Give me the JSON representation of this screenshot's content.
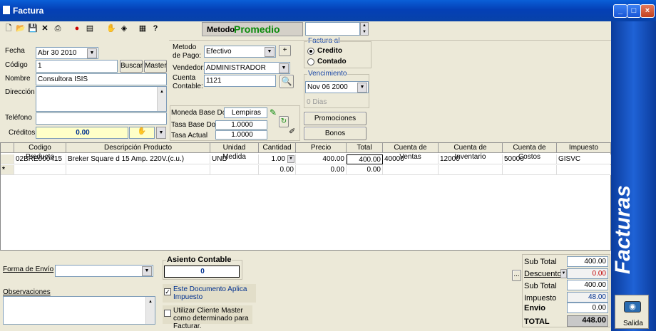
{
  "window": {
    "title": "Factura",
    "sidebar_label": "Facturas",
    "exit_label": "Salida"
  },
  "toolbar": {
    "metodo_label": "Metodo",
    "metodo_value": "Promedio"
  },
  "header": {
    "fecha_label": "Fecha",
    "fecha_value": "Abr 30 2010",
    "codigo_label": "Código",
    "codigo_value": "1",
    "buscar": "Buscar",
    "master": "Master",
    "nombre_label": "Nombre",
    "nombre_value": "Consultora ISIS",
    "direccion_label": "Dirección",
    "direccion_value": "",
    "telefono_label": "Teléfono",
    "telefono_value": "",
    "creditos_label": "Créditos",
    "creditos_value": "0.00",
    "metodo_pago_label1": "Metodo",
    "metodo_pago_label2": "de Pago:",
    "metodo_pago_value": "Efectivo",
    "vendedor_label": "Vendedor:",
    "vendedor_value": "ADMINISTRADOR",
    "cuenta_label1": "Cuenta",
    "cuenta_label2": "Contable:",
    "cuenta_value": "1121",
    "factura_al_label": "Factura al",
    "credito_label": "Credito",
    "contado_label": "Contado",
    "vencimiento_label": "Vencimiento",
    "vencimiento_value": "Nov 06 2000",
    "dias": "0 Dias",
    "moneda_label": "Moneda Base Doc",
    "moneda_value": "Lempiras",
    "tasa_base_label": "Tasa Base Doc",
    "tasa_base_value": "1.0000",
    "tasa_actual_label": "Tasa Actual",
    "tasa_actual_value": "1.0000",
    "promociones": "Promociones",
    "bonos": "Bonos"
  },
  "grid": {
    "columns": [
      "Codigo Producto",
      "Descripción Producto",
      "Unidad Medida",
      "Cantidad",
      "Precio",
      "Total",
      "Cuenta de Ventas",
      "Cuenta de Inventario",
      "Cuenta de Costos",
      "Impuesto"
    ],
    "row1": {
      "codigo": "02BRE000415",
      "descripcion": "Breker Square d 15 Amp. 220V.(c.u.)",
      "unidad": "UND",
      "cantidad": "1.00",
      "precio": "400.00",
      "total": "400.00",
      "ventas": "40000",
      "inventario": "12000",
      "costos": "50000",
      "impuesto": "GISVC"
    },
    "row2": {
      "marker": "*",
      "cantidad": "0.00",
      "precio": "0.00",
      "total": "0.00"
    }
  },
  "footer": {
    "forma_envio_label": "Forma de Envío",
    "forma_envio_value": "",
    "observaciones_label": "Observaciones",
    "asiento_label": "Asiento Contable",
    "asiento_value": "0",
    "aplica_impuesto": "Este Documento Aplica Impuesto",
    "cliente_master": "Utilizar Cliente Master como determinado para Facturar.",
    "more_btn": "..."
  },
  "totals": {
    "subtotal_label": "Sub Total",
    "subtotal": "400.00",
    "descuento_label": "Descuento",
    "descuento": "0.00",
    "subtotal2_label": "Sub Total",
    "subtotal2": "400.00",
    "impuesto_label": "Impuesto",
    "impuesto": "48.00",
    "envio_label": "Envio",
    "envio": "0.00",
    "total_label": "TOTAL",
    "total": "448.00"
  }
}
